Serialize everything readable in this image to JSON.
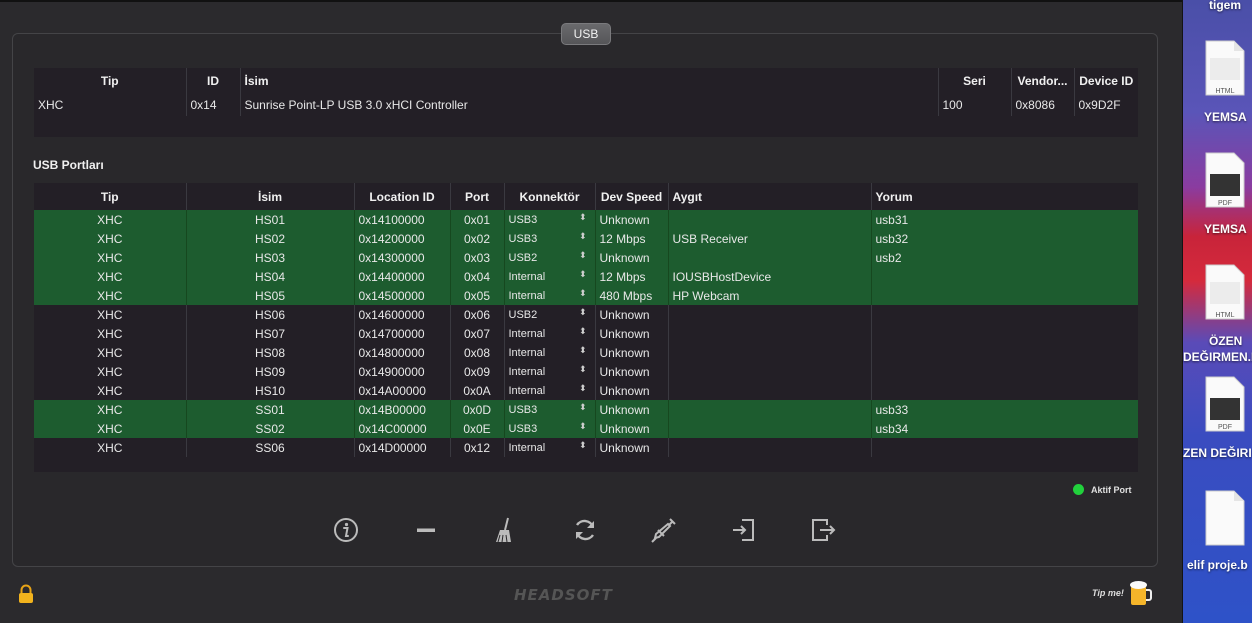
{
  "panel_tab": "USB",
  "controller": {
    "headers": [
      "Tip",
      "ID",
      "İsim",
      "Seri",
      "Vendor...",
      "Device ID"
    ],
    "row": [
      "XHC",
      "0x14",
      "Sunrise Point-LP USB 3.0 xHCI Controller",
      "100",
      "0x8086",
      "0x9D2F"
    ]
  },
  "ports_section_title": "USB Portları",
  "ports": {
    "headers": [
      "Tip",
      "İsim",
      "Location ID",
      "Port",
      "Konnektör",
      "Dev Speed",
      "Aygıt",
      "Yorum"
    ],
    "rows": [
      {
        "tip": "XHC",
        "isim": "HS01",
        "location": "0x14100000",
        "port": "0x01",
        "konnektor": "USB3",
        "speed": "Unknown",
        "aygit": "",
        "yorum": "usb31",
        "active": true
      },
      {
        "tip": "XHC",
        "isim": "HS02",
        "location": "0x14200000",
        "port": "0x02",
        "konnektor": "USB3",
        "speed": "12 Mbps",
        "aygit": "USB Receiver",
        "yorum": "usb32",
        "active": true
      },
      {
        "tip": "XHC",
        "isim": "HS03",
        "location": "0x14300000",
        "port": "0x03",
        "konnektor": "USB2",
        "speed": "Unknown",
        "aygit": "",
        "yorum": "usb2",
        "active": true
      },
      {
        "tip": "XHC",
        "isim": "HS04",
        "location": "0x14400000",
        "port": "0x04",
        "konnektor": "Internal",
        "speed": "12 Mbps",
        "aygit": "IOUSBHostDevice",
        "yorum": "",
        "active": true
      },
      {
        "tip": "XHC",
        "isim": "HS05",
        "location": "0x14500000",
        "port": "0x05",
        "konnektor": "Internal",
        "speed": "480 Mbps",
        "aygit": "HP Webcam",
        "yorum": "",
        "active": true
      },
      {
        "tip": "XHC",
        "isim": "HS06",
        "location": "0x14600000",
        "port": "0x06",
        "konnektor": "USB2",
        "speed": "Unknown",
        "aygit": "",
        "yorum": "",
        "active": false
      },
      {
        "tip": "XHC",
        "isim": "HS07",
        "location": "0x14700000",
        "port": "0x07",
        "konnektor": "Internal",
        "speed": "Unknown",
        "aygit": "",
        "yorum": "",
        "active": false
      },
      {
        "tip": "XHC",
        "isim": "HS08",
        "location": "0x14800000",
        "port": "0x08",
        "konnektor": "Internal",
        "speed": "Unknown",
        "aygit": "",
        "yorum": "",
        "active": false
      },
      {
        "tip": "XHC",
        "isim": "HS09",
        "location": "0x14900000",
        "port": "0x09",
        "konnektor": "Internal",
        "speed": "Unknown",
        "aygit": "",
        "yorum": "",
        "active": false
      },
      {
        "tip": "XHC",
        "isim": "HS10",
        "location": "0x14A00000",
        "port": "0x0A",
        "konnektor": "Internal",
        "speed": "Unknown",
        "aygit": "",
        "yorum": "",
        "active": false
      },
      {
        "tip": "XHC",
        "isim": "SS01",
        "location": "0x14B00000",
        "port": "0x0D",
        "konnektor": "USB3",
        "speed": "Unknown",
        "aygit": "",
        "yorum": "usb33",
        "active": true
      },
      {
        "tip": "XHC",
        "isim": "SS02",
        "location": "0x14C00000",
        "port": "0x0E",
        "konnektor": "USB3",
        "speed": "Unknown",
        "aygit": "",
        "yorum": "usb34",
        "active": true
      },
      {
        "tip": "XHC",
        "isim": "SS06",
        "location": "0x14D00000",
        "port": "0x12",
        "konnektor": "Internal",
        "speed": "Unknown",
        "aygit": "",
        "yorum": "",
        "active": false
      }
    ]
  },
  "legend_label": "Aktif Port",
  "colors": {
    "active_row": "#1d5c2f",
    "legend_dot": "#21d13c",
    "table_bg": "#231f26"
  },
  "toolbar_icons": [
    "info-icon",
    "minus-icon",
    "broom-icon",
    "refresh-icon",
    "syringe-icon",
    "import-icon",
    "export-icon"
  ],
  "footer": {
    "logo": "HEADSOFT",
    "tip_label": "Tip me!"
  },
  "desktop": {
    "labels": [
      "tigem",
      "YEMSA",
      "YEMSA",
      "ÖZEN",
      "DEĞIRMEN.H",
      "ZEN DEĞIRI",
      "elif proje.b"
    ],
    "file_badges": [
      "HTML",
      "PDF",
      "HTML",
      "PDF"
    ]
  }
}
